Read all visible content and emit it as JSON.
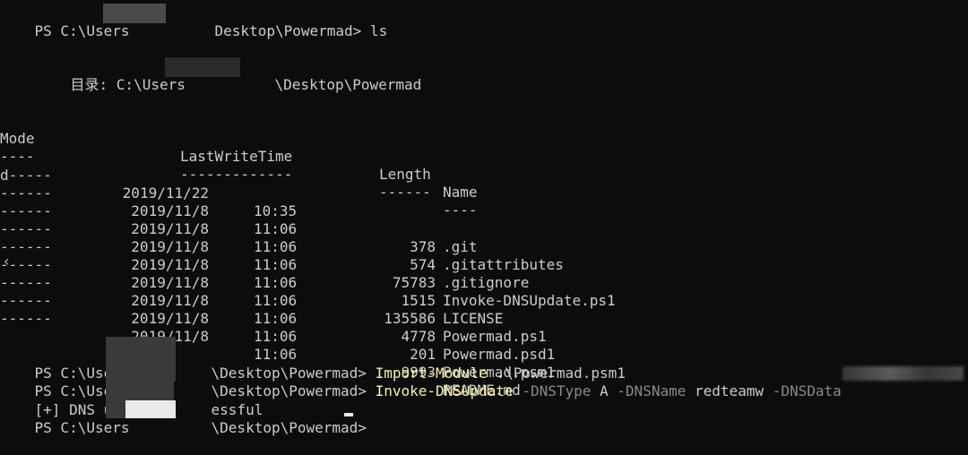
{
  "terminal": {
    "prompt_prefix": "PS C:\\Users",
    "prompt_suffix": "Desktop\\Powermad>",
    "prompt_suffix_bs": "\\Desktop\\Powermad>",
    "command_ls": " ls",
    "dir_label": "目录: C:\\Users",
    "dir_suffix": "\\Desktop\\Powermad",
    "headers": {
      "mode": "Mode",
      "lastwritetime": "LastWriteTime",
      "length": "Length",
      "name": "Name"
    },
    "separators": {
      "mode": "----",
      "lastwritetime": "-------------",
      "length": "------",
      "name": "----"
    },
    "rows": [
      {
        "mode": "d-----",
        "date": "2019/11/22",
        "time": "10:35",
        "length": "",
        "name": ".git"
      },
      {
        "mode": "------",
        "date": "2019/11/8",
        "time": "11:06",
        "length": "378",
        "name": ".gitattributes"
      },
      {
        "mode": "------",
        "date": "2019/11/8",
        "time": "11:06",
        "length": "574",
        "name": ".gitignore"
      },
      {
        "mode": "------",
        "date": "2019/11/8",
        "time": "11:06",
        "length": "75783",
        "name": "Invoke-DNSUpdate.ps1"
      },
      {
        "mode": "------",
        "date": "2019/11/8",
        "time": "11:06",
        "length": "1515",
        "name": "LICENSE"
      },
      {
        "mode": "------",
        "date": "2019/11/8",
        "time": "11:06",
        "length": "135586",
        "name": "Powermad.ps1"
      },
      {
        "mode": "------",
        "date": "2019/11/8",
        "time": "11:06",
        "length": "4778",
        "name": "Powermad.psd1"
      },
      {
        "mode": "------",
        "date": "2019/11/8",
        "time": "11:06",
        "length": "201",
        "name": "Powermad.psm1"
      },
      {
        "mode": "------",
        "date": "2019/11/8",
        "time": "11:06",
        "length": "9993",
        "name": "README.md"
      }
    ],
    "cmd_import_keyword": "Import-Module",
    "cmd_import_arg": " .\\Powermad.psm1",
    "cmd_invoke_keyword": "Invoke-DNSUpdate",
    "cmd_invoke_p1": " -DNSType",
    "cmd_invoke_v1": " A",
    "cmd_invoke_p2": " -DNSName",
    "cmd_invoke_v2": " redteamw",
    "cmd_invoke_p3": " -DNSData",
    "result_prefix": "[+] DNS upda",
    "result_suffix": "essful",
    "scroll_glyph": "‹"
  },
  "colors": {
    "background": "#0c0c0c",
    "foreground": "#cccccc",
    "command": "#f9f1a5",
    "parameter": "#8a8a8a"
  }
}
